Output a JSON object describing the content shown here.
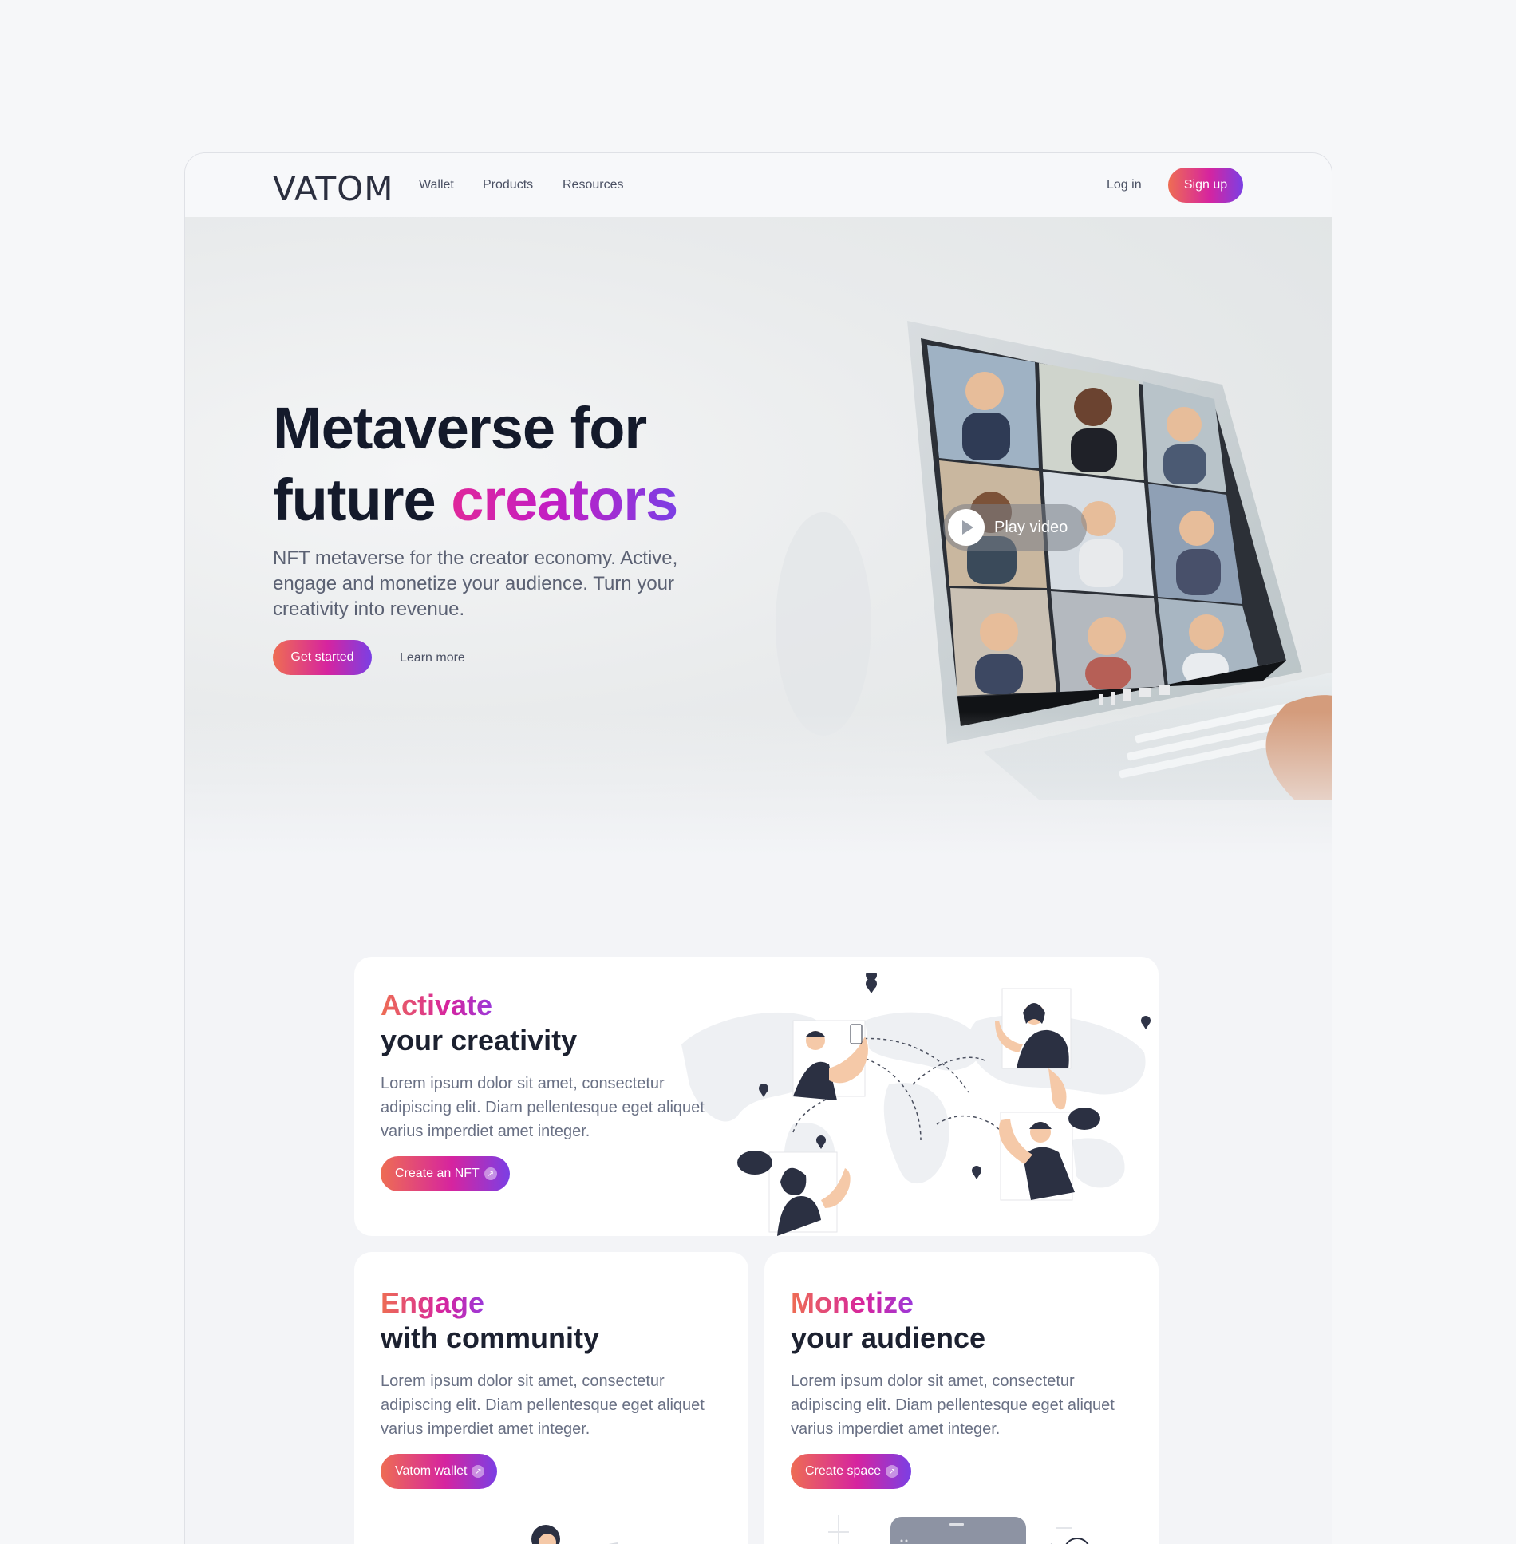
{
  "nav": {
    "logo": "VATOM",
    "links": [
      "Wallet",
      "Products",
      "Resources"
    ],
    "login": "Log in",
    "signup": "Sign up"
  },
  "hero": {
    "title_line1": "Metaverse for",
    "title_line2_plain": "future ",
    "title_line2_accent": "creators",
    "subtitle": "NFT metaverse for the creator economy. Active, engage and monetize your audience. Turn your creativity into revenue.",
    "cta": "Get started",
    "learn_more": "Learn more",
    "play_video": "Play video"
  },
  "cards": [
    {
      "kicker": "Activate",
      "title": "your creativity",
      "body": "Lorem ipsum dolor sit amet, consectetur adipiscing elit. Diam pellentesque eget aliquet varius imperdiet amet integer.",
      "button": "Create an NFT"
    },
    {
      "kicker": "Engage",
      "title": "with community",
      "body": "Lorem ipsum dolor sit amet, consectetur adipiscing elit. Diam pellentesque eget aliquet varius imperdiet amet integer.",
      "button": "Vatom wallet"
    },
    {
      "kicker": "Monetize",
      "title": "your audience",
      "body": "Lorem ipsum dolor sit amet, consectetur adipiscing elit. Diam pellentesque eget aliquet varius imperdiet amet integer.",
      "button": "Create space"
    }
  ],
  "colors": {
    "gradient_start": "#ee6d53",
    "gradient_mid": "#d6249f",
    "gradient_end": "#7b3fe4",
    "heading": "#141a2b",
    "body_text": "#697084"
  },
  "icons": [
    "play-icon",
    "arrow-up-right-icon",
    "map-pin-icon"
  ]
}
